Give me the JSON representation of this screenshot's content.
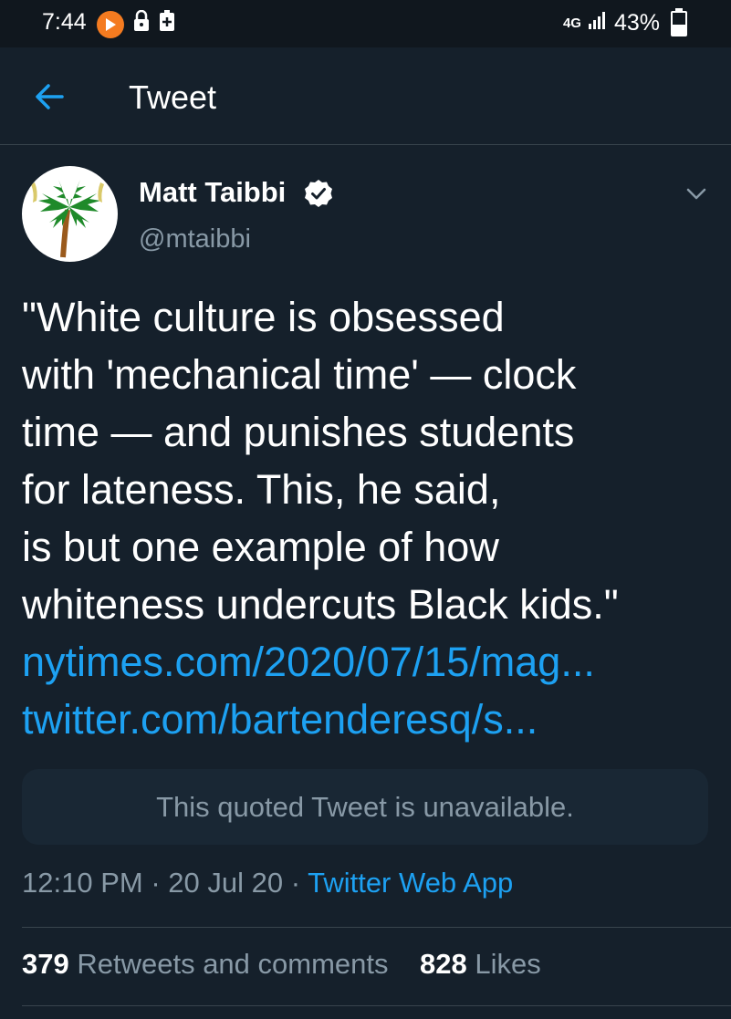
{
  "status_bar": {
    "time": "7:44",
    "network": "4G",
    "battery": "43%",
    "battery_level": 0.43,
    "icons": [
      "play-icon",
      "lock-icon",
      "plus-box-icon",
      "signal-icon",
      "battery-icon"
    ]
  },
  "header": {
    "title": "Tweet",
    "back_icon": "arrow-left-icon"
  },
  "tweet": {
    "author_name": "Matt Taibbi",
    "author_handle": "@mtaibbi",
    "verified": true,
    "text_lines": [
      "\"White culture is obsessed",
      "with 'mechanical time' — clock",
      "time — and punishes students",
      "for lateness. This, he said,",
      "is but one example of how",
      "whiteness undercuts Black kids.\""
    ],
    "links": [
      "nytimes.com/2020/07/15/mag...",
      "twitter.com/bartenderesq/s..."
    ],
    "quoted_unavailable": "This quoted Tweet is unavailable.",
    "time": "12:10 PM",
    "date": "20 Jul 20",
    "separator": " · ",
    "source": "Twitter Web App",
    "retweets_count": "379",
    "retweets_label": "Retweets and comments",
    "likes_count": "828",
    "likes_label": "Likes"
  },
  "colors": {
    "background": "#15202b",
    "accent": "#1da1f2",
    "secondary_text": "#8899a6"
  }
}
